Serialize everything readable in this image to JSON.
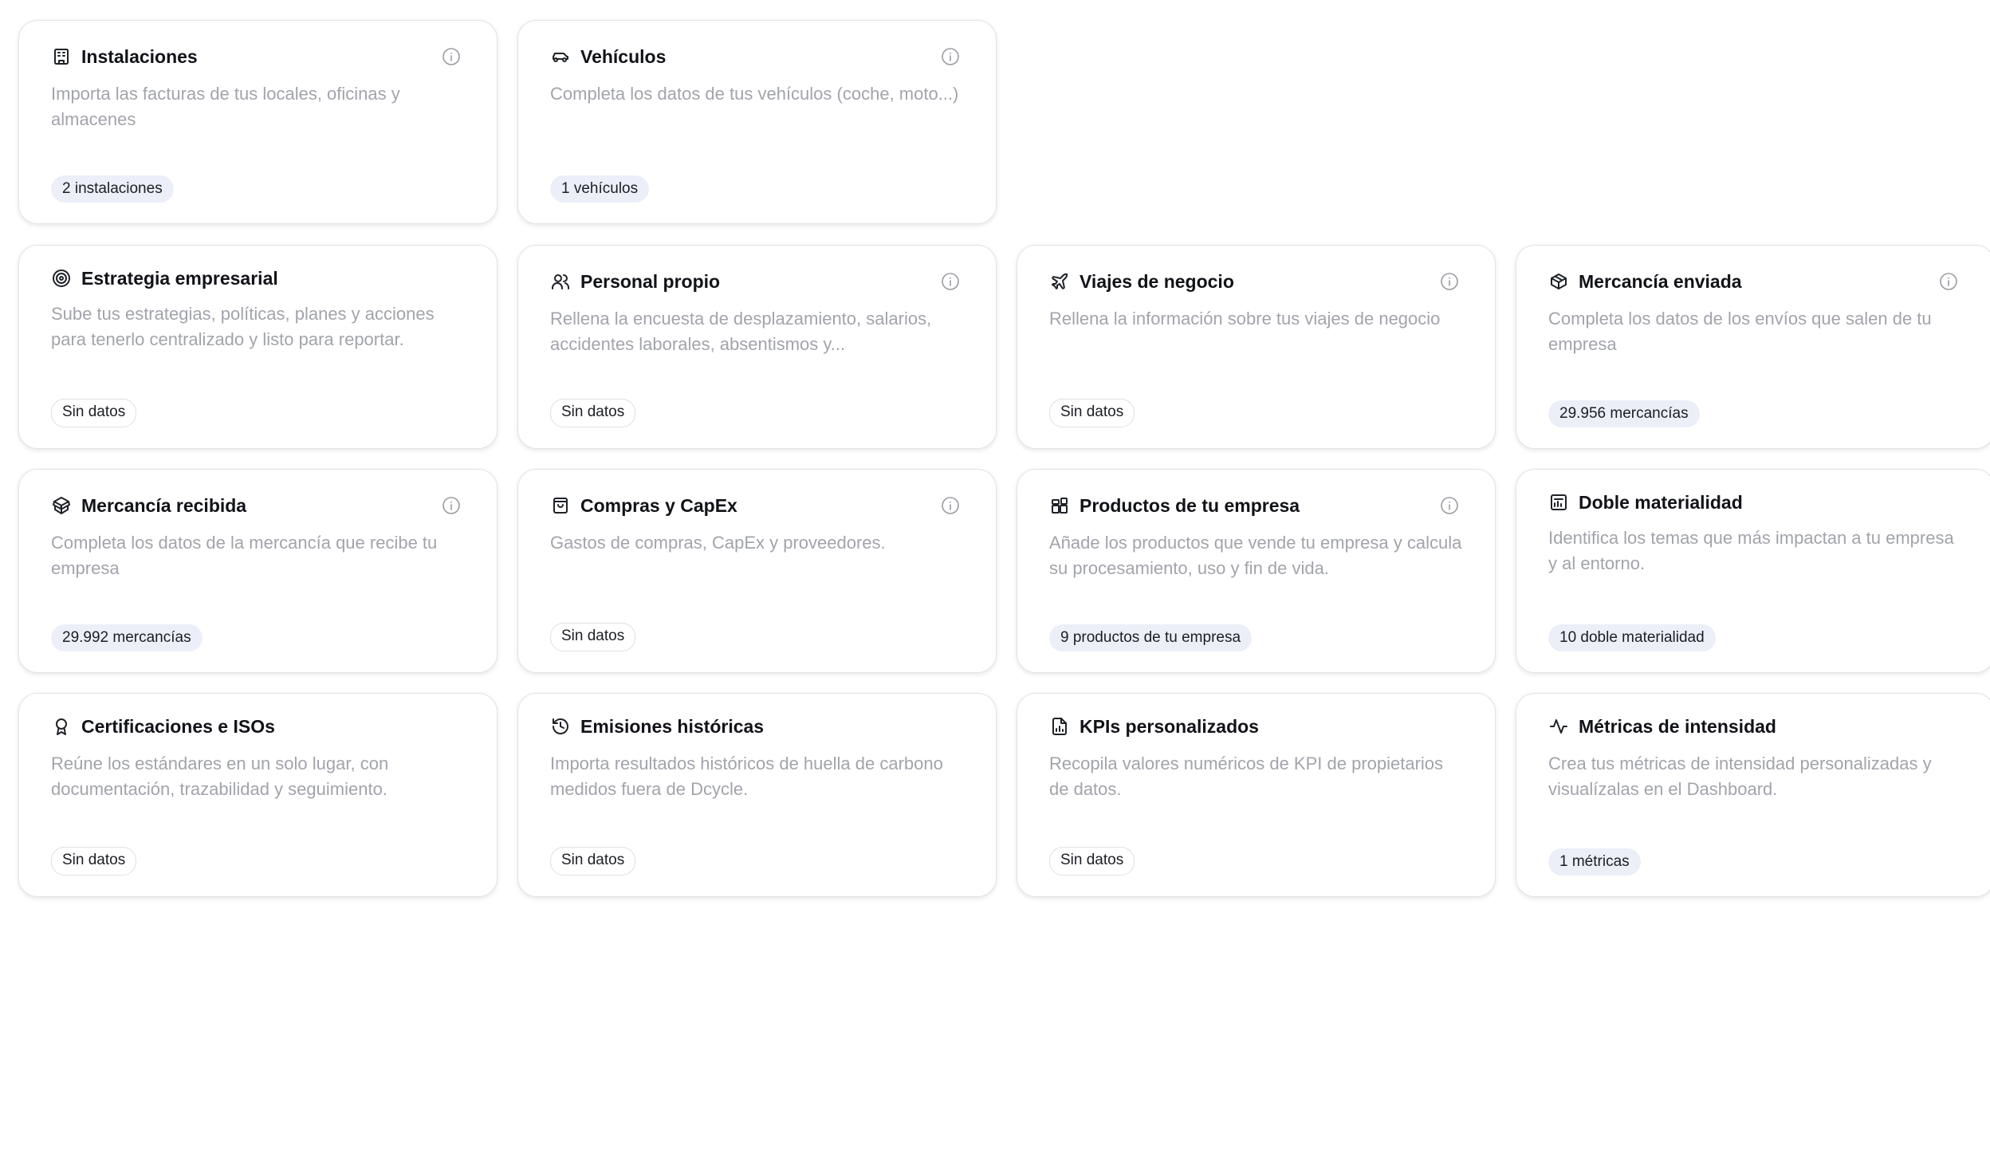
{
  "cards": [
    {
      "title": "Instalaciones",
      "icon": "building-icon",
      "description": "Importa las facturas de tus locales, oficinas y almacenes",
      "badge": "2 instalaciones",
      "badge_filled": true,
      "has_info": true
    },
    {
      "title": "Vehículos",
      "icon": "car-icon",
      "description": "Completa los datos de tus vehículos (coche, moto...)",
      "badge": "1 vehículos",
      "badge_filled": true,
      "has_info": true
    },
    {
      "title": "Estrategia empresarial",
      "icon": "target-icon",
      "description": "Sube tus estrategias, políticas, planes y acciones para tenerlo centralizado y listo para reportar.",
      "badge": "Sin datos",
      "badge_filled": false,
      "has_info": false
    },
    {
      "title": "Personal propio",
      "icon": "users-icon",
      "description": "Rellena la encuesta de desplazamiento, salarios, accidentes laborales, absentismos y...",
      "badge": "Sin datos",
      "badge_filled": false,
      "has_info": true
    },
    {
      "title": "Viajes de negocio",
      "icon": "plane-icon",
      "description": "Rellena la información sobre tus viajes de negocio",
      "badge": "Sin datos",
      "badge_filled": false,
      "has_info": true
    },
    {
      "title": "Mercancía enviada",
      "icon": "package-icon",
      "description": "Completa los datos de los envíos que salen de tu empresa",
      "badge": "29.956 mercancías",
      "badge_filled": true,
      "has_info": true
    },
    {
      "title": "Mercancía recibida",
      "icon": "package-open-icon",
      "description": "Completa los datos de la mercancía que recibe tu empresa",
      "badge": "29.992 mercancías",
      "badge_filled": true,
      "has_info": true
    },
    {
      "title": "Compras y CapEx",
      "icon": "shopping-bag-icon",
      "description": "Gastos de compras, CapEx y proveedores.",
      "badge": "Sin datos",
      "badge_filled": false,
      "has_info": true
    },
    {
      "title": "Productos de tu empresa",
      "icon": "product-blocks-icon",
      "description": "Añade los productos que vende tu empresa y calcula su procesamiento, uso y fin de vida.",
      "badge": "9 productos de tu empresa",
      "badge_filled": true,
      "has_info": true
    },
    {
      "title": "Doble materialidad",
      "icon": "chart-square-icon",
      "description": "Identifica los temas que más impactan a tu empresa y al entorno.",
      "badge": "10 doble materialidad",
      "badge_filled": true,
      "has_info": false
    },
    {
      "title": "Certificaciones e ISOs",
      "icon": "award-icon",
      "description": "Reúne los estándares en un solo lugar, con documentación, trazabilidad y seguimiento.",
      "badge": "Sin datos",
      "badge_filled": false,
      "has_info": false
    },
    {
      "title": "Emisiones históricas",
      "icon": "history-icon",
      "description": "Importa resultados históricos de huella de carbono medidos fuera de Dcycle.",
      "badge": "Sin datos",
      "badge_filled": false,
      "has_info": false
    },
    {
      "title": "KPIs personalizados",
      "icon": "file-chart-icon",
      "description": "Recopila valores numéricos de KPI de propietarios de datos.",
      "badge": "Sin datos",
      "badge_filled": false,
      "has_info": false
    },
    {
      "title": "Métricas de intensidad",
      "icon": "activity-icon",
      "description": "Crea tus métricas de intensidad personalizadas y visualízalas en el Dashboard.",
      "badge": "1 métricas",
      "badge_filled": true,
      "has_info": false
    }
  ]
}
